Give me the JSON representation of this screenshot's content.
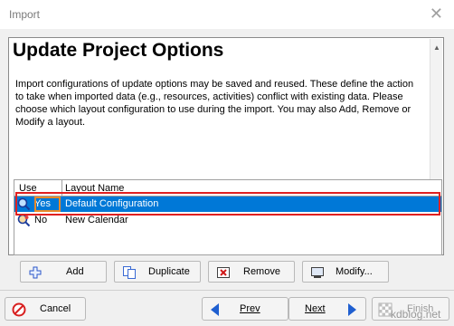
{
  "window": {
    "title": "Import"
  },
  "header": {
    "heading": "Update Project Options",
    "description": "Import configurations of update options may be saved and reused.  These define the action to take when imported data (e.g., resources, activities) conflict with existing data.  Please choose which layout configuration to use during the import. You may also Add, Remove or Modify a layout."
  },
  "grid": {
    "columns": [
      "Use",
      "Layout Name"
    ],
    "rows": [
      {
        "use": "Yes",
        "name": "Default Configuration",
        "selected": true
      },
      {
        "use": "No",
        "name": "New Calendar",
        "selected": false
      }
    ]
  },
  "actions": {
    "add": "Add",
    "duplicate": "Duplicate",
    "remove": "Remove",
    "modify": "Modify..."
  },
  "footer": {
    "cancel": "Cancel",
    "prev": "Prev",
    "next": "Next",
    "finish": "Finish",
    "watermark": "kdblog.net"
  },
  "colors": {
    "selection": "#0078d7",
    "highlight_outline": "#e02020",
    "accent_outline": "#e88a2a"
  }
}
